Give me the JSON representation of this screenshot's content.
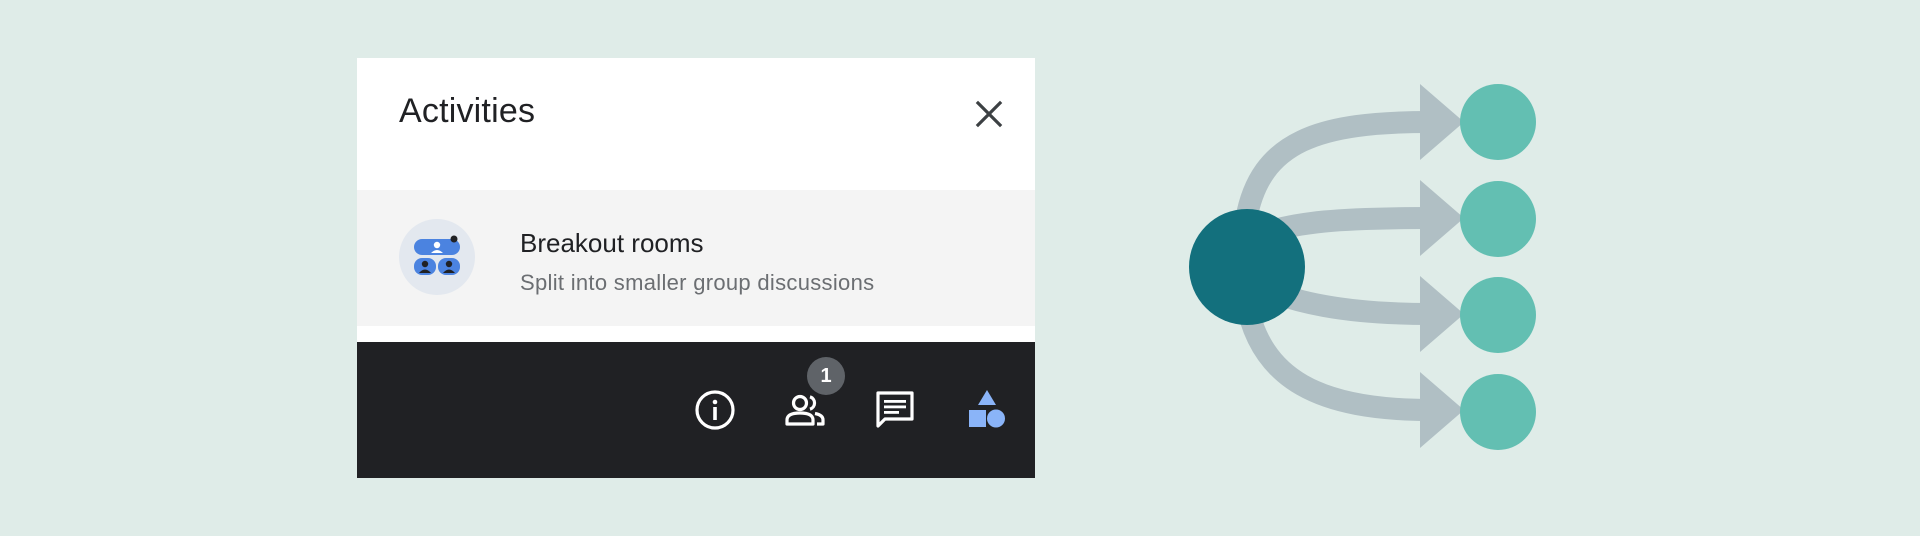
{
  "panel": {
    "title": "Activities",
    "close_icon": "close-icon",
    "items": [
      {
        "name": "Breakout rooms",
        "description": "Split into smaller group discussions",
        "icon": "breakout-rooms-icon"
      }
    ]
  },
  "toolbar": {
    "info_icon": "info-icon",
    "people_icon": "people-icon",
    "people_count": "1",
    "chat_icon": "chat-icon",
    "activities_icon": "activities-shapes-icon"
  },
  "illustration": {
    "description_icon": "one-to-many-split-diagram",
    "source_node_count": 1,
    "target_node_count": 4
  },
  "colors": {
    "background": "#dfece8",
    "toolbar_bg": "#202124",
    "item_bg": "#f4f4f4",
    "accent_blue": "#8ab4f8",
    "source_node": "#13707d",
    "target_node": "#63bfb2",
    "arrow": "#b0bfc4"
  }
}
